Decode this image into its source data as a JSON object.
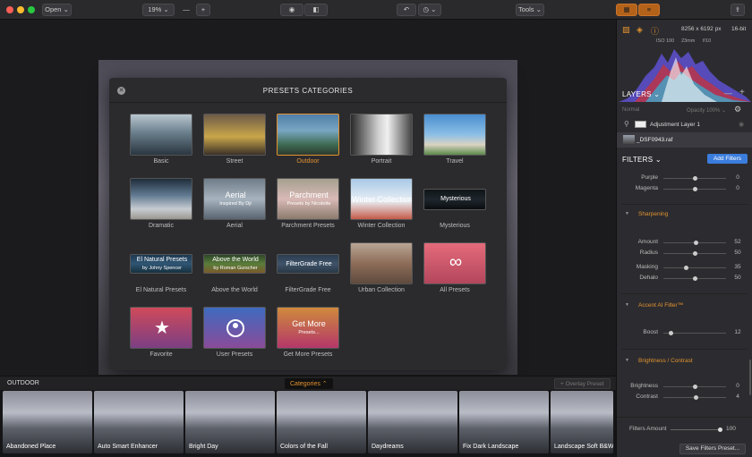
{
  "toolbar": {
    "open": "Open",
    "zoom": "19%",
    "tools": "Tools",
    "minus": "—",
    "plus": "+"
  },
  "modal": {
    "title": "PRESETS CATEGORIES",
    "close": "✕"
  },
  "categories": [
    {
      "label": "Basic"
    },
    {
      "label": "Street"
    },
    {
      "label": "Outdoor",
      "selected": true
    },
    {
      "label": "Portrait"
    },
    {
      "label": "Travel"
    },
    {
      "label": "Dramatic"
    },
    {
      "label": "Aerial",
      "thumb_title": "Aerial",
      "thumb_sub": "Inspired By Dji"
    },
    {
      "label": "Parchment Presets",
      "thumb_title": "Parchment",
      "thumb_sub": "Presets by Nicolette"
    },
    {
      "label": "Winter Collection",
      "thumb_title": "Winter Collection"
    },
    {
      "label": "Mysterious",
      "thumb_title": "Mysterious"
    },
    {
      "label": "El Natural Presets",
      "thumb_title": "El Natural Presets",
      "thumb_sub": "by Johny Spencer"
    },
    {
      "label": "Above the World",
      "thumb_title": "Above the World",
      "thumb_sub": "by Roman Gurscher"
    },
    {
      "label": "FilterGrade Free",
      "thumb_title": "FilterGrade Free"
    },
    {
      "label": "Urban Collection"
    },
    {
      "label": "All Presets",
      "thumb_icon": "∞"
    },
    {
      "label": "Favorite",
      "thumb_icon": "★"
    },
    {
      "label": "User Presets"
    },
    {
      "label": "Get More Presets",
      "thumb_title": "Get More",
      "thumb_sub": "Presets..."
    }
  ],
  "filmstrip": {
    "section": "OUTDOOR",
    "categories_btn": "Categories ⌃",
    "overlay_btn": "+ Overlay Preset",
    "items": [
      "Abandoned Place",
      "Auto Smart Enhancer",
      "Bright Day",
      "Colors of the Fall",
      "Daydreams",
      "Fix Dark Landscape",
      "Landscape Soft B&W"
    ]
  },
  "panel": {
    "dims": "8256 x 6192 px",
    "bitdepth": "16-bit",
    "iso": "ISO 100",
    "focal": "23mm",
    "aperture": "f/10",
    "layers_title": "LAYERS ⌄",
    "blend": "Normal",
    "opacity": "Opacity 100% ⌄",
    "layer1": "Adjustment Layer 1",
    "layer2": "_DSF0943.raf",
    "filters_title": "FILTERS ⌄",
    "add_filters": "Add Filters",
    "sharpening": "Sharpening",
    "accent": "Accent AI Filter™",
    "bc": "Brightness / Contrast",
    "filters_amount_label": "Filters Amount",
    "filters_amount_value": "100",
    "save_filters": "Save Filters Preset..."
  },
  "sliders": {
    "purple": {
      "label": "Purple",
      "value": "0",
      "pos": 0.5
    },
    "magenta": {
      "label": "Magenta",
      "value": "0",
      "pos": 0.5
    },
    "amount": {
      "label": "Amount",
      "value": "52",
      "pos": 0.52
    },
    "radius": {
      "label": "Radius",
      "value": "50",
      "pos": 0.5
    },
    "masking": {
      "label": "Masking",
      "value": "35",
      "pos": 0.35
    },
    "dehalo": {
      "label": "Dehalo",
      "value": "50",
      "pos": 0.5
    },
    "boost": {
      "label": "Boost",
      "value": "12",
      "pos": 0.12
    },
    "brightness": {
      "label": "Brightness",
      "value": "0",
      "pos": 0.5
    },
    "contrast": {
      "label": "Contrast",
      "value": "4",
      "pos": 0.52
    }
  },
  "colors": {
    "accent": "#e3922f",
    "primary": "#3b7ddd"
  }
}
